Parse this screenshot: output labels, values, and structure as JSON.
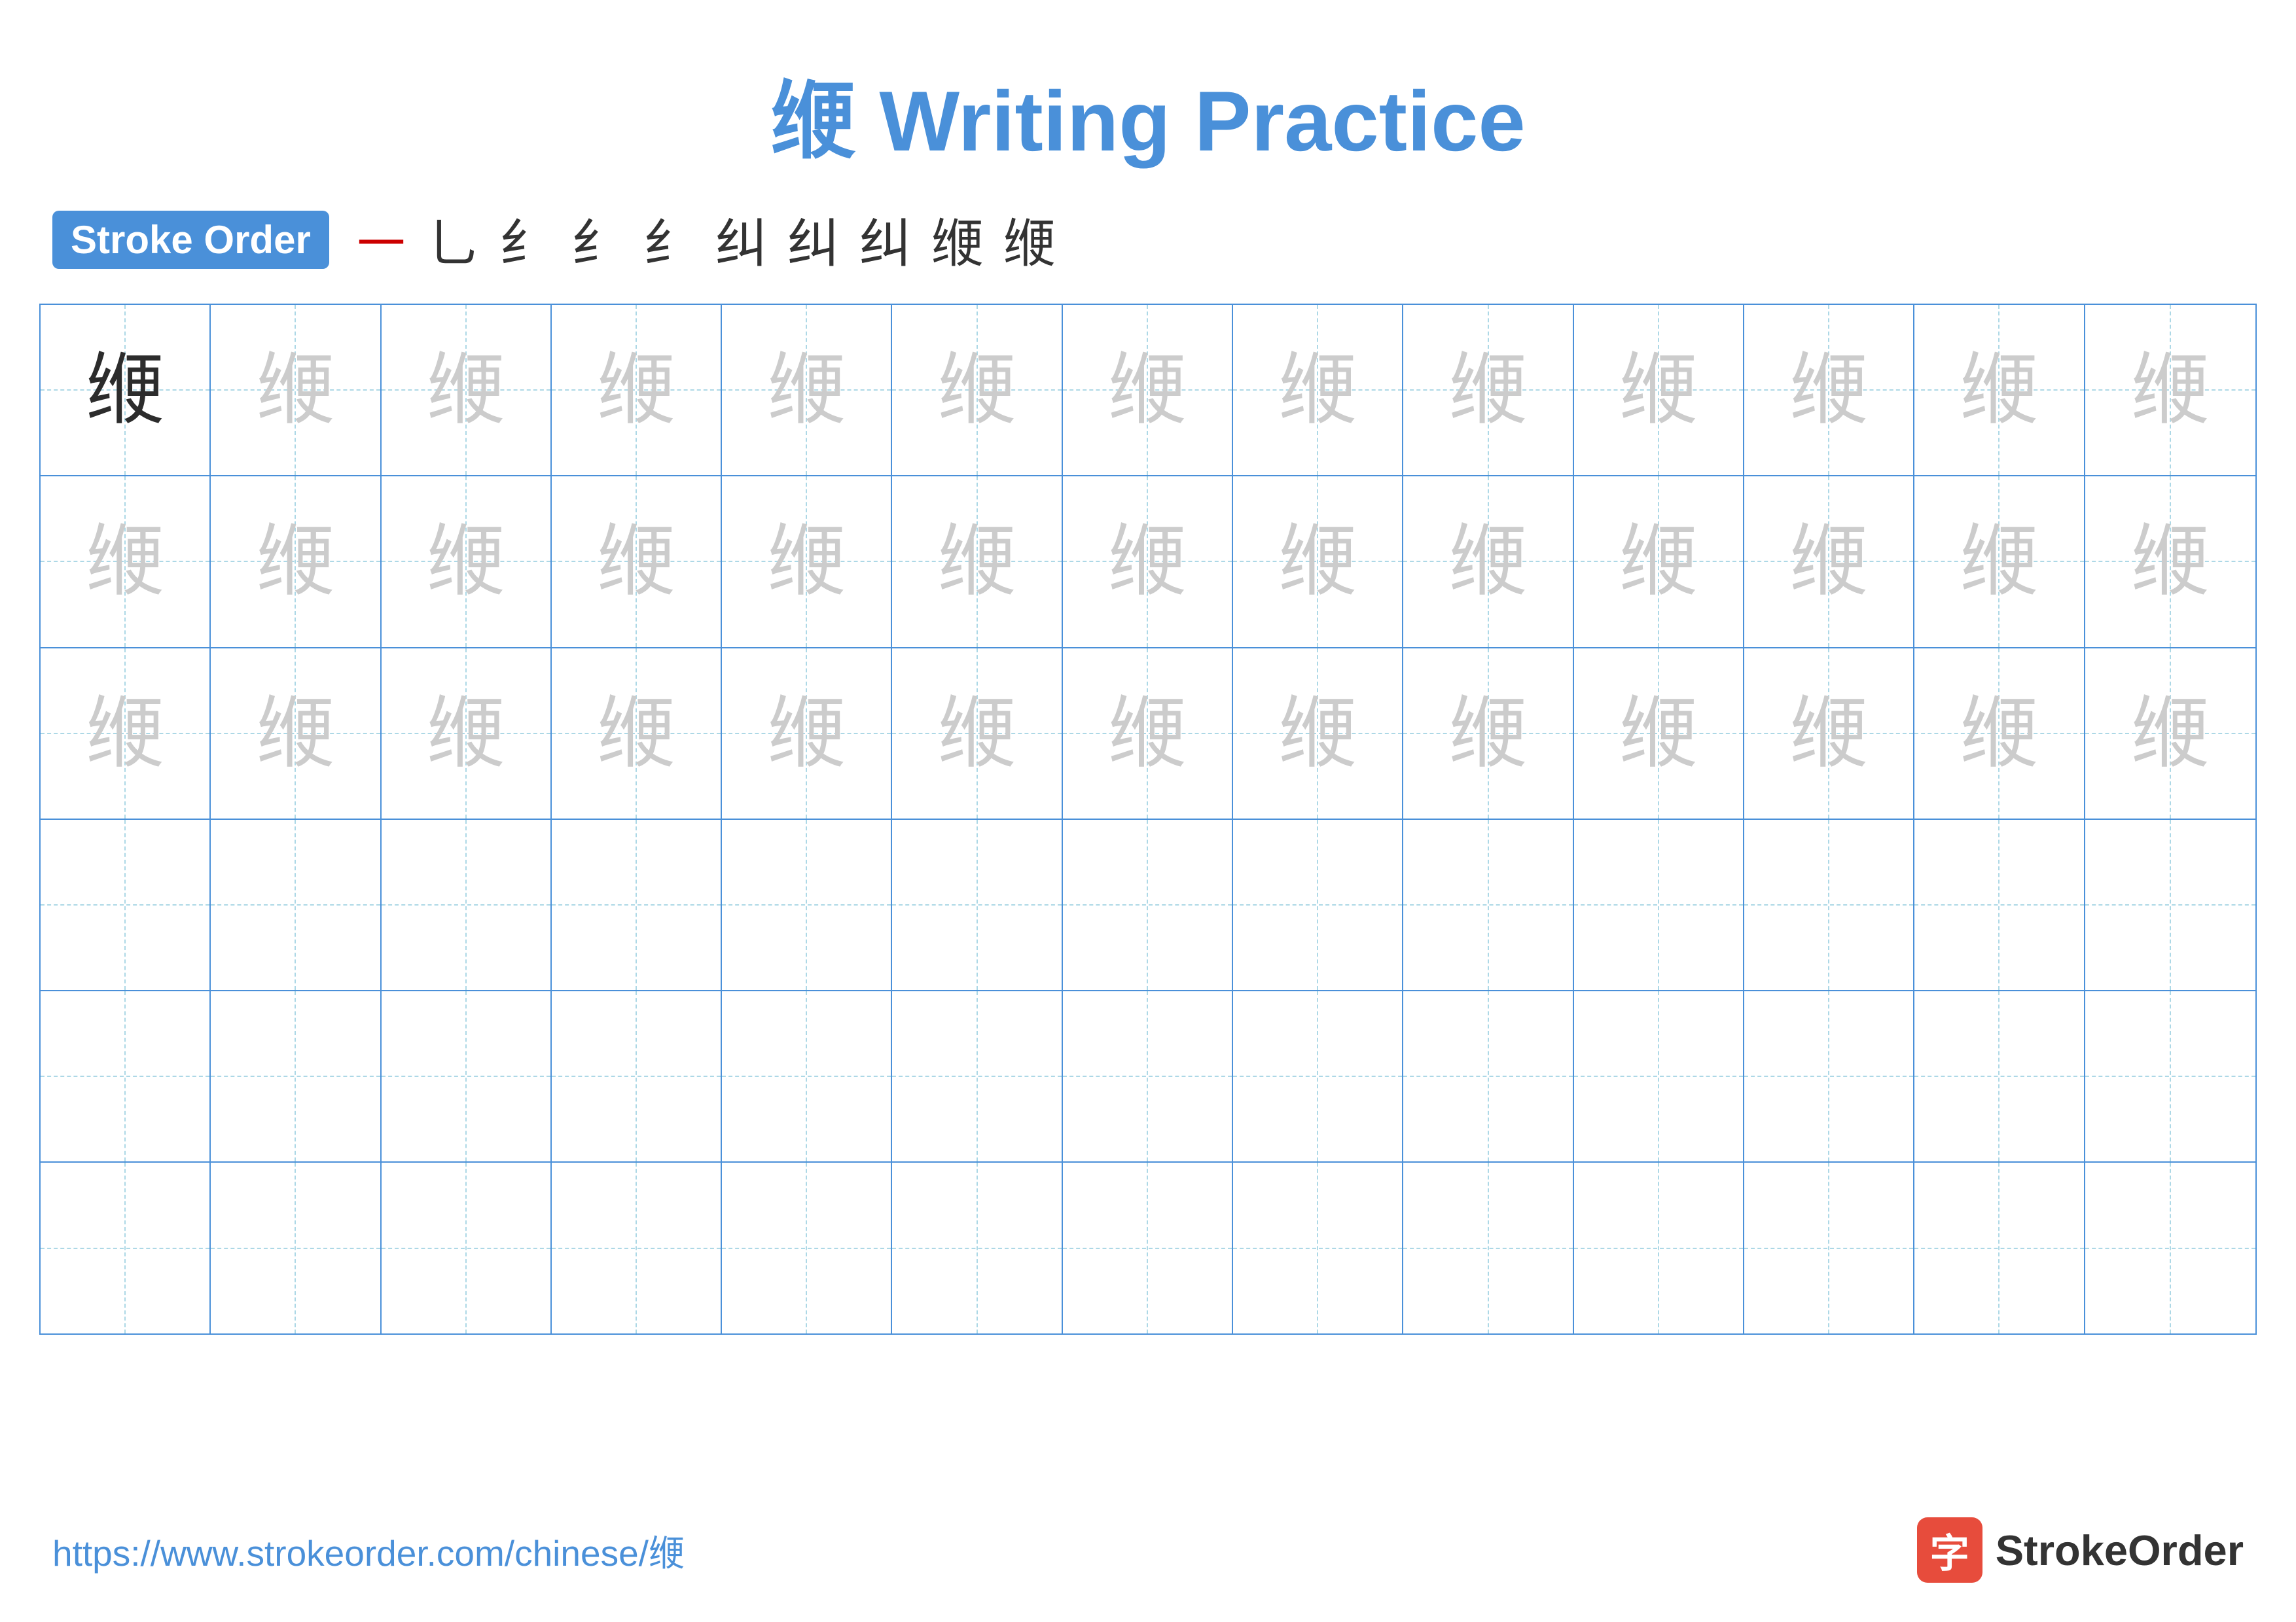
{
  "title": {
    "text": "缏 Writing Practice",
    "color": "#4A90D9"
  },
  "stroke_order": {
    "badge_label": "Stroke Order",
    "steps": [
      "㇐",
      "乚",
      "纟",
      "纟",
      "纟",
      "纠",
      "纠",
      "纠",
      "缏",
      "缏"
    ]
  },
  "character": "缏",
  "grid": {
    "rows": 6,
    "cols": 13,
    "row1_first_dark": true,
    "row1_rest_light": true,
    "row2_all_light": true,
    "row3_all_light": true
  },
  "footer": {
    "url": "https://www.strokeorder.com/chinese/缏",
    "logo_text": "StrokeOrder",
    "logo_icon": "字"
  }
}
